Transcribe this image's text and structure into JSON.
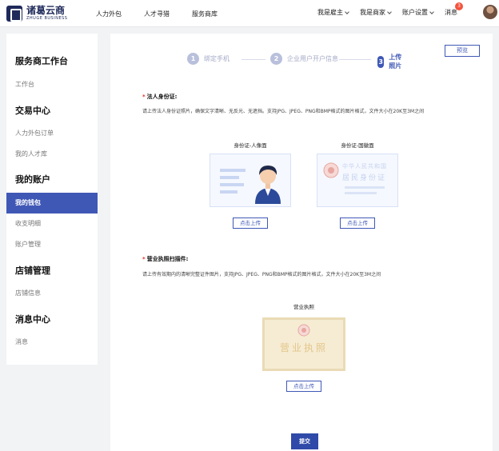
{
  "header": {
    "logo_cn": "诸葛云商",
    "logo_en": "ZHUGE BUSINESS",
    "nav": [
      "人力外包",
      "人才寻猎",
      "服务商库"
    ],
    "right_nav": [
      "我是雇主",
      "我是商家",
      "账户设置"
    ],
    "messages_label": "消息",
    "message_count": "3"
  },
  "sidebar": {
    "sections": [
      {
        "title": "服务商工作台",
        "items": [
          "工作台"
        ]
      },
      {
        "title": "交易中心",
        "items": [
          "人力外包订单",
          "我的人才库"
        ]
      },
      {
        "title": "我的账户",
        "items": [
          "我的钱包",
          "收支明细",
          "账户管理"
        ]
      },
      {
        "title": "店铺管理",
        "items": [
          "店铺信息"
        ]
      },
      {
        "title": "消息中心",
        "items": [
          "消息"
        ]
      }
    ],
    "active_item": "我的钱包"
  },
  "main": {
    "preview_label": "预览",
    "steps": [
      {
        "num": "1",
        "label": "绑定手机"
      },
      {
        "num": "2",
        "label": "企业用户开户信息"
      },
      {
        "num": "3",
        "label": "上传照片"
      }
    ],
    "current_step": 3,
    "id_section": {
      "title": "法人身份证:",
      "desc": "请上传法人身份证照片，确保文字清晰、无反光、无遮挡。支持JPG、JPEG、PNG和BMP格式的图片格式，文件大小在20K至3M之间",
      "front_label": "身份证-人像面",
      "back_label": "身份证-国徽面",
      "back_card_line1": "中华人民共和国",
      "back_card_line2": "居民身份证",
      "upload_label": "点击上传"
    },
    "license_section": {
      "title": "营业执照扫描件:",
      "desc": "请上传有效期内的清晰完整证件图片，支持JPG、JPEG、PNG和BMP格式的图片格式，文件大小在20K至3M之间",
      "card_label": "营业执照",
      "card_text": "营业执照",
      "upload_label": "点击上传"
    },
    "submit_label": "提交"
  },
  "colors": {
    "primary": "#3f58b6",
    "badge": "#f4533d",
    "required": "#e0301e"
  }
}
